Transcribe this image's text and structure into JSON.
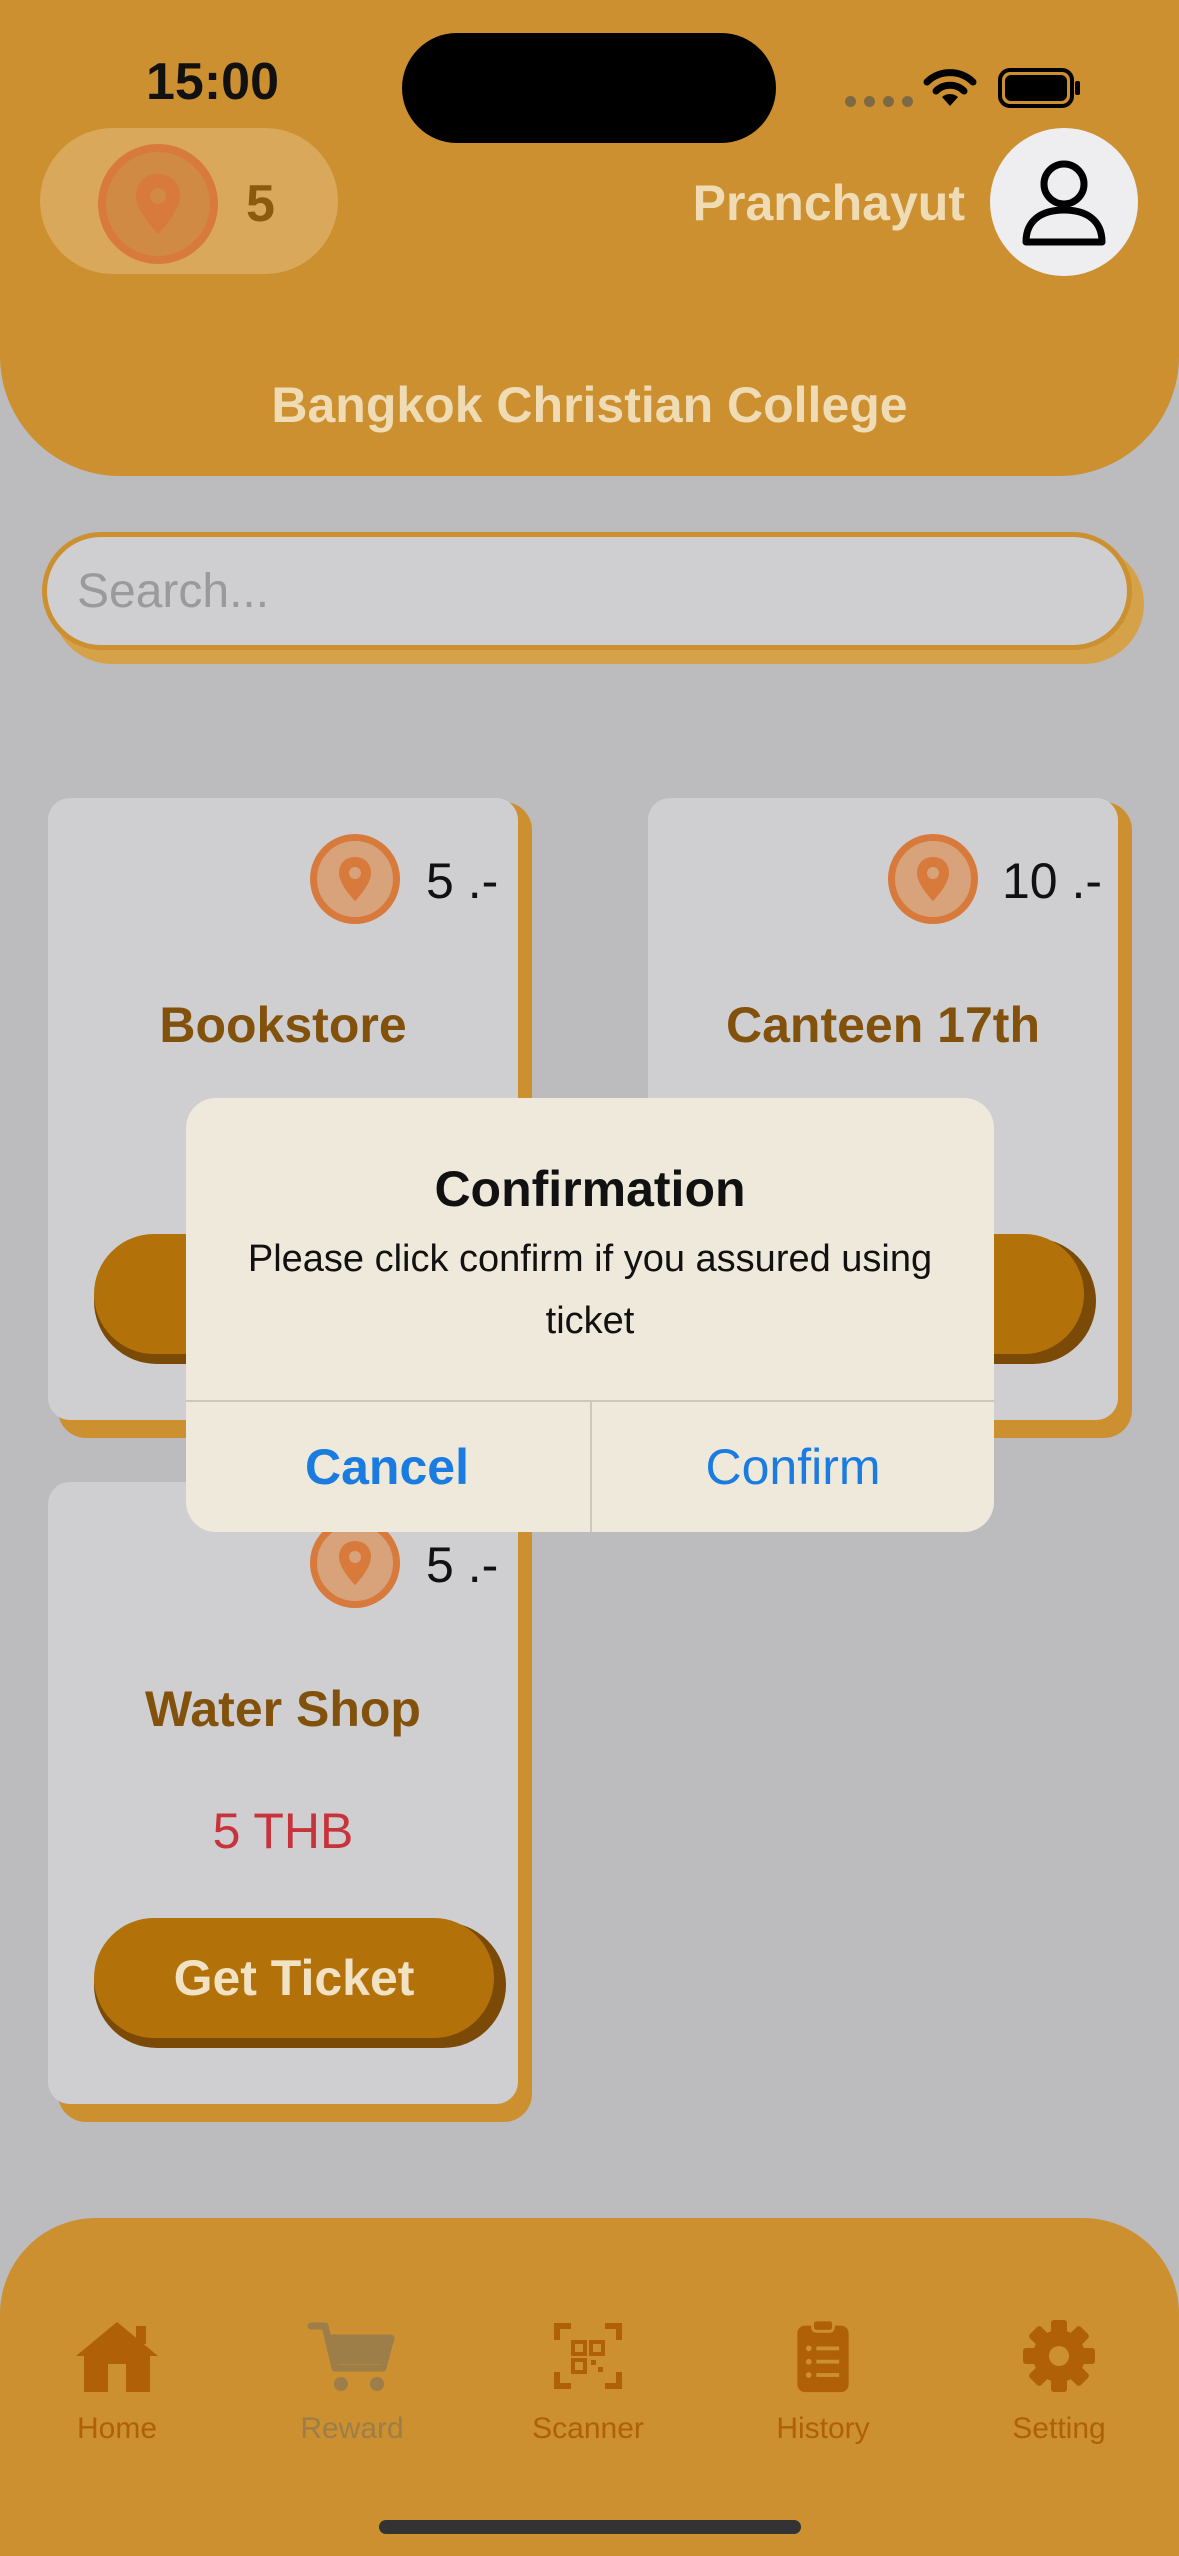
{
  "status_bar": {
    "time": "15:00"
  },
  "header": {
    "points": "5",
    "username": "Pranchayut",
    "college": "Bangkok Christian College"
  },
  "search": {
    "placeholder": "Search...",
    "value": ""
  },
  "cards": [
    {
      "title": "Bookstore",
      "points": "5 .-"
    },
    {
      "title": "Canteen 17th",
      "points": "10 .-"
    },
    {
      "title": "Water Shop",
      "points": "5 .-",
      "price": "5 THB",
      "button": "Get Ticket"
    }
  ],
  "dialog": {
    "title": "Confirmation",
    "message": "Please click confirm if you assured using ticket",
    "cancel": "Cancel",
    "confirm": "Confirm"
  },
  "tabs": [
    {
      "label": "Home",
      "icon": "home-icon",
      "active": true
    },
    {
      "label": "Reward",
      "icon": "cart-icon",
      "active": false
    },
    {
      "label": "Scanner",
      "icon": "qr-scan-icon",
      "active": true
    },
    {
      "label": "History",
      "icon": "clipboard-icon",
      "active": true
    },
    {
      "label": "Setting",
      "icon": "gear-icon",
      "active": true
    }
  ],
  "colors": {
    "accent": "#cc9030",
    "button": "#b37209",
    "price_red": "#c8323a",
    "link_blue": "#1a7be0",
    "tab_active": "#b06006",
    "tab_inactive": "#9e7e48"
  }
}
